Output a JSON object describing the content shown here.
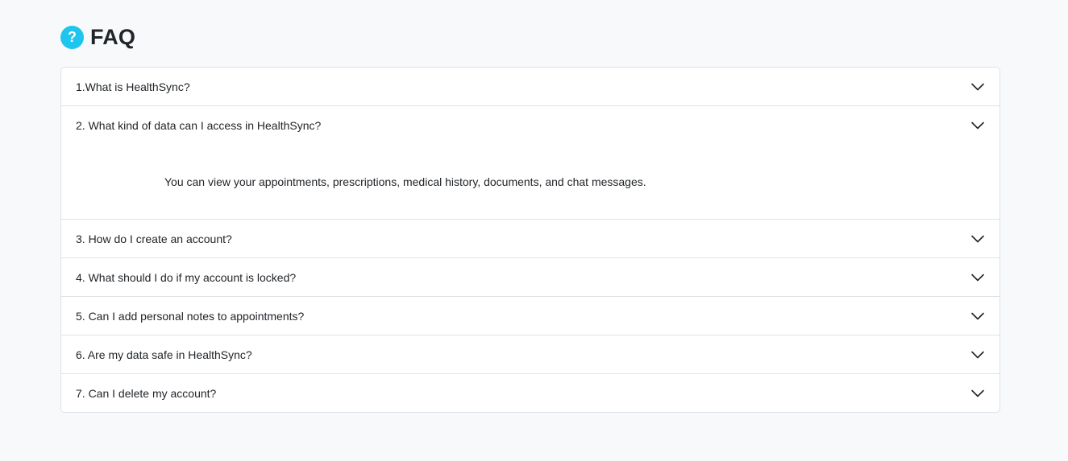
{
  "header": {
    "icon": "question-circle-icon",
    "icon_glyph": "?",
    "icon_color": "#1ec5ee",
    "title": "FAQ"
  },
  "faq": {
    "items": [
      {
        "question": "1.What is HealthSync?",
        "expanded": false
      },
      {
        "question": "2. What kind of data can I access in HealthSync?",
        "expanded": true,
        "answer": "You can view your appointments, prescriptions, medical history, documents, and chat messages."
      },
      {
        "question": "3. How do I create an account?",
        "expanded": false
      },
      {
        "question": "4. What should I do if my account is locked?",
        "expanded": false
      },
      {
        "question": "5. Can I add personal notes to appointments?",
        "expanded": false
      },
      {
        "question": "6. Are my data safe in HealthSync?",
        "expanded": false
      },
      {
        "question": "7. Can I delete my account?",
        "expanded": false
      }
    ],
    "chevron_icon": "chevron-down-icon"
  },
  "colors": {
    "background": "#f8f9fb",
    "border": "#dee2e6",
    "accent": "#1ec5ee"
  }
}
